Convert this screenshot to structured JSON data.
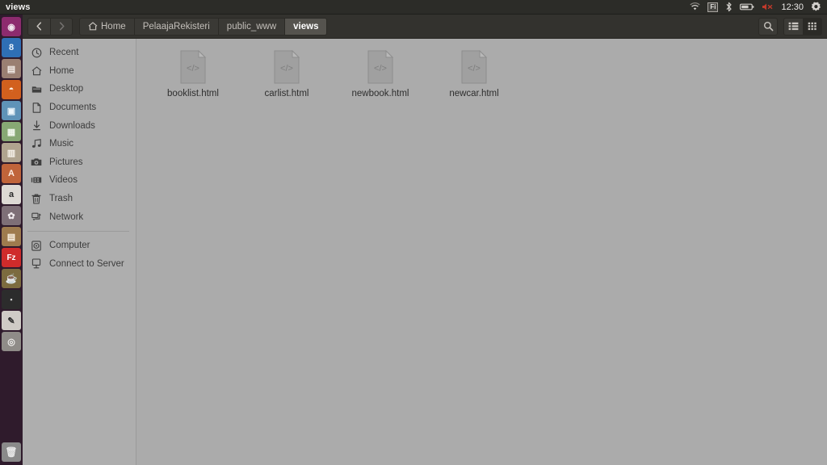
{
  "panel": {
    "title": "views",
    "tray": {
      "wifi_icon": "wifi-icon",
      "keyboard_layout": "Fi",
      "bluetooth_icon": "bluetooth-icon",
      "battery_icon": "battery-icon",
      "volume_icon": "volume-muted-icon",
      "clock": "12:30",
      "settings_icon": "gear-icon"
    }
  },
  "launcher": {
    "items": [
      {
        "name": "dash-home",
        "glyph": "◉",
        "bg": "#8d2b6e",
        "fg": "#f0e4ec",
        "focused": false,
        "running": false
      },
      {
        "name": "firefox-alt",
        "glyph": "8",
        "bg": "#2f6fb5",
        "fg": "#eaf2fb",
        "focused": false,
        "running": false
      },
      {
        "name": "libreoffice-start",
        "glyph": "▤",
        "bg": "#9a7f72",
        "fg": "#f3ece8",
        "focused": false,
        "running": true
      },
      {
        "name": "firefox",
        "glyph": "◓",
        "bg": "#d2601e",
        "fg": "#fff2e6",
        "focused": false,
        "running": true
      },
      {
        "name": "libreoffice-writer",
        "glyph": "▣",
        "bg": "#5f93b8",
        "fg": "#eef6fb",
        "focused": false,
        "running": true
      },
      {
        "name": "libreoffice-calc",
        "glyph": "▦",
        "bg": "#87a874",
        "fg": "#f0f6ec",
        "focused": false,
        "running": false
      },
      {
        "name": "libreoffice-impress",
        "glyph": "▥",
        "bg": "#b0a48f",
        "fg": "#f6f2ea",
        "focused": false,
        "running": false
      },
      {
        "name": "ubuntu-software",
        "glyph": "A",
        "bg": "#c0643a",
        "fg": "#fdeee4",
        "focused": false,
        "running": false
      },
      {
        "name": "amazon",
        "glyph": "a",
        "bg": "#ddd9d4",
        "fg": "#2a2a2a",
        "focused": false,
        "running": false
      },
      {
        "name": "system-settings",
        "glyph": "✿",
        "bg": "#7e6f77",
        "fg": "#efe9ec",
        "focused": false,
        "running": false
      },
      {
        "name": "files-nautilus",
        "glyph": "▤",
        "bg": "#9e7b4e",
        "fg": "#fbf2e4",
        "focused": true,
        "running": true
      },
      {
        "name": "filezilla",
        "glyph": "Fz",
        "bg": "#cf2b2b",
        "fg": "#ffffff",
        "focused": false,
        "running": false
      },
      {
        "name": "netbeans-java",
        "glyph": "☕",
        "bg": "#7c6b3f",
        "fg": "#f7e9b8",
        "focused": false,
        "running": false
      },
      {
        "name": "terminal",
        "glyph": "▪",
        "bg": "#2c2c2c",
        "fg": "#cfcfcf",
        "focused": false,
        "running": true
      },
      {
        "name": "text-editor",
        "glyph": "✎",
        "bg": "#cfcbc6",
        "fg": "#2d2d2d",
        "focused": false,
        "running": true
      },
      {
        "name": "screenshot-tool",
        "glyph": "◎",
        "bg": "#8f8c88",
        "fg": "#efeeec",
        "focused": false,
        "running": true
      },
      {
        "name": "trash",
        "glyph": "🗑",
        "bg": "#8a8a8a",
        "fg": "#e8e8e8",
        "focused": false,
        "running": false
      }
    ]
  },
  "toolbar": {
    "back_label": "Back",
    "forward_label": "Forward",
    "breadcrumbs": [
      {
        "label": "Home",
        "icon": "home-icon",
        "active": false
      },
      {
        "label": "PelaajaRekisteri",
        "icon": "",
        "active": false
      },
      {
        "label": "public_www",
        "icon": "",
        "active": false
      },
      {
        "label": "views",
        "icon": "",
        "active": true
      }
    ],
    "search_label": "Search",
    "list_view_label": "List view",
    "grid_view_label": "Grid view"
  },
  "sidebar": {
    "items": [
      {
        "label": "Recent",
        "icon": "clock-icon"
      },
      {
        "label": "Home",
        "icon": "home-icon"
      },
      {
        "label": "Desktop",
        "icon": "folder-icon"
      },
      {
        "label": "Documents",
        "icon": "document-icon"
      },
      {
        "label": "Downloads",
        "icon": "download-arrow-icon"
      },
      {
        "label": "Music",
        "icon": "music-note-icon"
      },
      {
        "label": "Pictures",
        "icon": "camera-icon"
      },
      {
        "label": "Videos",
        "icon": "film-icon"
      },
      {
        "label": "Trash",
        "icon": "trash-icon"
      },
      {
        "label": "Network",
        "icon": "network-icon"
      }
    ],
    "items_lower": [
      {
        "label": "Computer",
        "icon": "computer-icon"
      },
      {
        "label": "Connect to Server",
        "icon": "server-icon"
      }
    ]
  },
  "files": [
    {
      "name": "booklist.html",
      "icon": "html-file-icon"
    },
    {
      "name": "carlist.html",
      "icon": "html-file-icon"
    },
    {
      "name": "newbook.html",
      "icon": "html-file-icon"
    },
    {
      "name": "newcar.html",
      "icon": "html-file-icon"
    }
  ],
  "colors": {
    "panel_bg": "#2c2c28",
    "toolbar_bg": "#33322e",
    "launcher_bg": "#2f1b2c",
    "sidebar_bg": "#aeaeae",
    "content_bg": "#ababab",
    "crumb_active_bg": "#55534e"
  }
}
